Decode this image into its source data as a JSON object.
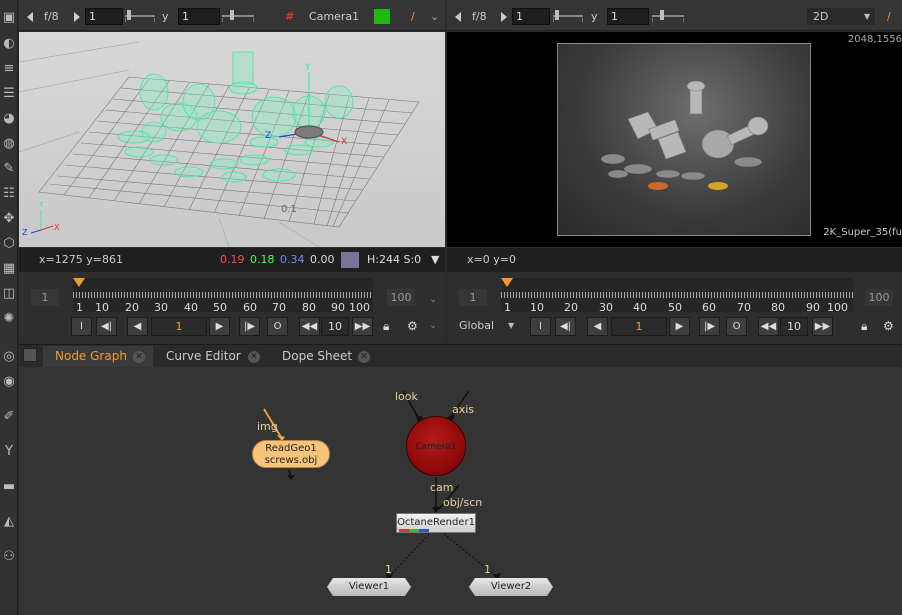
{
  "viewer_left": {
    "frame_label": "f/8",
    "frame_value": "1",
    "y_label": "y",
    "y_value": "1",
    "camera_label": "Camera1",
    "status_coords": "x=1275 y=861",
    "status_r": "0.19",
    "status_g": "0.18",
    "status_b": "0.34",
    "status_a": "0.00",
    "status_hsv": "H:244 S:0",
    "axis_label": "0.1",
    "timeline_start": "1",
    "timeline_end": "100",
    "ticks": [
      "1",
      "10",
      "20",
      "30",
      "40",
      "50",
      "60",
      "70",
      "80",
      "90",
      "100"
    ],
    "current_frame": "1",
    "step": "10"
  },
  "viewer_right": {
    "frame_label": "f/8",
    "frame_value": "1",
    "y_label": "y",
    "y_value": "1",
    "view_mode": "2D",
    "resolution": "2048,1556",
    "format_label": "2K_Super_35(fu",
    "status_coords": "x=0 y=0",
    "timeline_start": "1",
    "timeline_end": "100",
    "ticks": [
      "1",
      "10",
      "20",
      "30",
      "40",
      "50",
      "60",
      "70",
      "80",
      "90",
      "100"
    ],
    "current_frame": "1",
    "step": "10",
    "global_label": "Global"
  },
  "tabs": [
    {
      "label": "Node Graph",
      "active": true
    },
    {
      "label": "Curve Editor",
      "active": false
    },
    {
      "label": "Dope Sheet",
      "active": false
    }
  ],
  "nodes": {
    "readgeo_line1": "ReadGeo1",
    "readgeo_line2": "screws.obj",
    "readgeo_input": "img",
    "camera": "Camera1",
    "camera_input_look": "look",
    "camera_input_axis": "axis",
    "camera_output": "cam",
    "octane_input": "obj/scn",
    "octane": "OctaneRender1",
    "viewer1": "Viewer1",
    "viewer2": "Viewer2",
    "viewer1_input": "1",
    "viewer2_input": "1"
  },
  "colors": {
    "accent": "#f39a2b",
    "wireframe": "#3fe89a",
    "camera_node": "#a00d0d",
    "readgeo_node": "#f7c27a"
  }
}
